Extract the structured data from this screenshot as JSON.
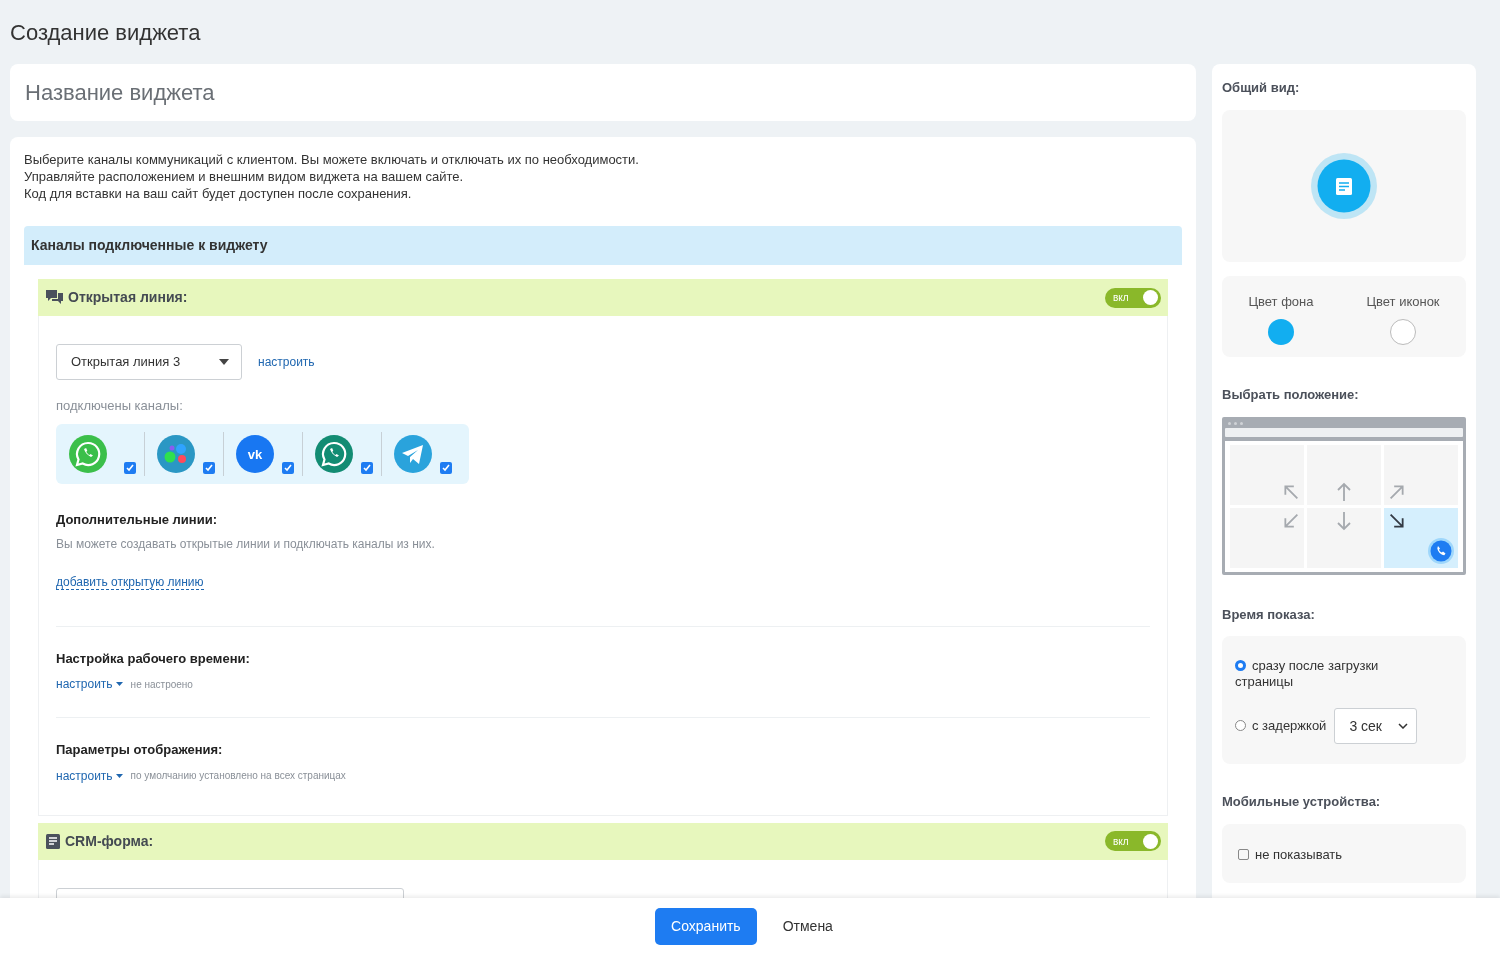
{
  "page_title": "Создание виджета",
  "widget_name": {
    "placeholder": "Название виджета"
  },
  "description": [
    "Выберите каналы коммуникаций с клиентом. Вы можете включать и отключать их по необходимости.",
    "Управляйте расположением и внешним видом виджета на вашем сайте.",
    "Код для вставки на ваш сайт будет доступен после сохранения."
  ],
  "channels_header": "Каналы подключенные к виджету",
  "open_line": {
    "title": "Открытая линия:",
    "toggle": {
      "label": "вкл",
      "on": true
    },
    "select": {
      "value": "Открытая линия 3"
    },
    "configure_link": "настроить",
    "connected_label": "подключены каналы:",
    "channels": [
      {
        "kind": "chat-phone",
        "color": "#3bbf4a",
        "checked": true
      },
      {
        "kind": "dots",
        "color": "#2a97c4",
        "checked": true
      },
      {
        "kind": "letters",
        "label": "vk",
        "color": "#1877f2",
        "checked": true
      },
      {
        "kind": "chat-phone",
        "color": "#128c73",
        "checked": true
      },
      {
        "kind": "plane",
        "color": "#2aa3dc",
        "checked": true
      }
    ],
    "extra_lines": {
      "title": "Дополнительные линии:",
      "text": "Вы можете создавать открытые линии и подключать каналы из них.",
      "link": "добавить открытую линию"
    },
    "settings": [
      {
        "title": "Настройка рабочего времени:",
        "link": "настроить",
        "status": "не настроено"
      },
      {
        "title": "Параметры отображения:",
        "link": "настроить",
        "status": "по умолчанию установлено на всех страницах"
      }
    ]
  },
  "crm_form": {
    "title": "CRM-форма:",
    "toggle": {
      "label": "вкл",
      "on": true
    }
  },
  "appearance": {
    "title": "Общий вид:",
    "colors": [
      {
        "label": "Цвет фона",
        "color": "#12aef0"
      },
      {
        "label": "Цвет иконок",
        "color": "#ffffff"
      }
    ]
  },
  "position": {
    "title": "Выбрать положение:",
    "cells": [
      {
        "kind": "up-left",
        "selected": false
      },
      {
        "kind": "up",
        "selected": false
      },
      {
        "kind": "up-right",
        "selected": false
      },
      {
        "kind": "down-left",
        "selected": false
      },
      {
        "kind": "down",
        "selected": false
      },
      {
        "kind": "down-right",
        "selected": true
      }
    ]
  },
  "show_time": {
    "title": "Время показа:",
    "options": [
      {
        "label": "сразу после загрузки страницы",
        "selected": true
      },
      {
        "label": "с задержкой",
        "selected": false,
        "delay": "3 сек"
      }
    ]
  },
  "mobile": {
    "title": "Мобильные устройства:",
    "option": {
      "label": "не показывать",
      "checked": false
    }
  },
  "buttons": [
    {
      "kind": "primary",
      "label": "Сохранить"
    },
    {
      "kind": "plain",
      "label": "Отмена"
    }
  ]
}
